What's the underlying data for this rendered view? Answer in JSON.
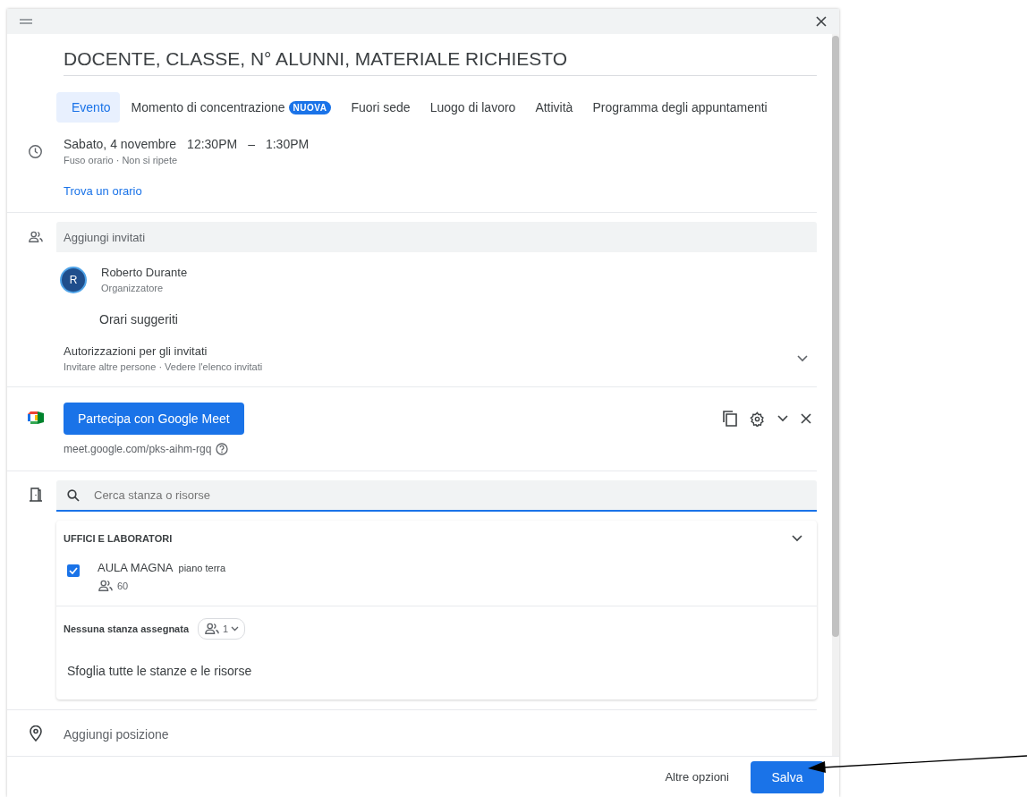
{
  "title": "DOCENTE, CLASSE, N° ALUNNI, MATERIALE RICHIESTO",
  "tabs": [
    {
      "label": "Evento",
      "selected": true
    },
    {
      "label": "Momento di concentrazione",
      "selected": false,
      "badge": "NUOVA"
    },
    {
      "label": "Fuori sede",
      "selected": false
    },
    {
      "label": "Luogo di lavoro",
      "selected": false
    },
    {
      "label": "Attività",
      "selected": false
    },
    {
      "label": "Programma degli appuntamenti",
      "selected": false
    }
  ],
  "datetime": {
    "date": "Sabato, 4 novembre",
    "start": "12:30PM",
    "separator": "–",
    "end": "1:30PM",
    "details": "Fuso orario · Non si ripete"
  },
  "find_time": "Trova un orario",
  "guests": {
    "placeholder": "Aggiungi invitati",
    "organizer": {
      "initial": "R",
      "name": "Roberto Durante",
      "role": "Organizzatore"
    },
    "suggested": "Orari suggeriti",
    "permissions": {
      "title": "Autorizzazioni per gli invitati",
      "detail": "Invitare altre persone · Vedere l'elenco invitati"
    }
  },
  "meet": {
    "button": "Partecipa con Google Meet",
    "url": "meet.google.com/pks-aihm-rgq"
  },
  "rooms": {
    "placeholder": "Cerca stanza o risorse",
    "group": "UFFICI E LABORATORI",
    "items": [
      {
        "name": "AULA MAGNA",
        "note": "piano terra",
        "capacity": "60",
        "checked": true
      }
    ],
    "unassigned": {
      "label": "Nessuna stanza assegnata",
      "count": "1"
    },
    "browse": "Sfoglia tutte le stanze e le risorse"
  },
  "location": {
    "placeholder": "Aggiungi posizione"
  },
  "footer": {
    "more": "Altre opzioni",
    "save": "Salva"
  }
}
